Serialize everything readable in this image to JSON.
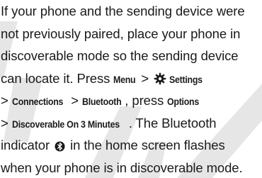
{
  "lines": {
    "l1": "If your phone and the sending device were",
    "l2": "not previously paired, place your phone in",
    "l3": "discoverable mode so the sending device",
    "l4_a": "can locate it. Press ",
    "l4_menu": "Menu",
    "l4_gt": " > ",
    "l4_settings": "Settings",
    "l5_gt1": "> ",
    "l5_connections": "Connections",
    "l5_gt2": " > ",
    "l5_bluetooth": "Bluetooth",
    "l5_press": ", press ",
    "l5_options": "Options",
    "l6_gt": "> ",
    "l6_discoverable": "Discoverable On 3 Minutes",
    "l6_rest": ". The Bluetooth",
    "l7_a": "indicator ",
    "l7_b": " in the home screen flashes",
    "l8": "when your phone is in discoverable mode."
  },
  "icons": {
    "settings": "gear-icon",
    "bluetooth": "bluetooth-indicator-icon"
  },
  "watermark": {
    "text": "DRAFT",
    "color": "#d9d9d9"
  }
}
